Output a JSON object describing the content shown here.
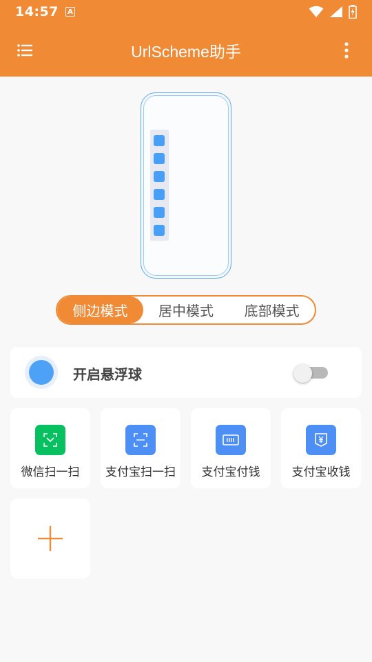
{
  "status_bar": {
    "time": "14:57",
    "notification_icon": "A",
    "icons": [
      "wifi-icon",
      "signal-icon",
      "battery-charging-icon"
    ]
  },
  "app_bar": {
    "title": "UrlScheme助手",
    "left_icon": "menu-list-icon",
    "right_icon": "more-vertical-icon"
  },
  "preview": {
    "mode": "side",
    "dots_count": 6,
    "colors": {
      "frame": "#5aa7ee",
      "dot": "#47a0f5"
    }
  },
  "mode_tabs": {
    "items": [
      "侧边模式",
      "居中模式",
      "底部模式"
    ],
    "selected": 0
  },
  "float_ball": {
    "label": "开启悬浮球",
    "enabled": false
  },
  "shortcuts": [
    {
      "label": "微信扫一扫",
      "icon": "wechat-scan-icon",
      "color": "#07c160"
    },
    {
      "label": "支付宝扫一扫",
      "icon": "alipay-scan-icon",
      "color": "#4d8ff5"
    },
    {
      "label": "支付宝付钱",
      "icon": "alipay-pay-icon",
      "color": "#4d8ff5"
    },
    {
      "label": "支付宝收钱",
      "icon": "alipay-receive-icon",
      "color": "#4d8ff5"
    }
  ],
  "add_button": {
    "icon": "plus-icon"
  },
  "theme": {
    "accent": "#f08a35",
    "background": "#f8f8f8"
  }
}
